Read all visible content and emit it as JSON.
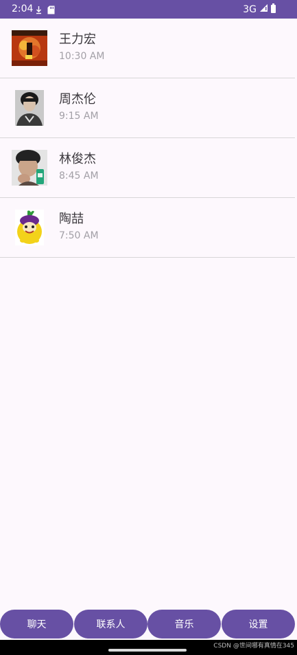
{
  "status_bar": {
    "time": "2:04",
    "network": "3G",
    "icons": [
      "download-arrow-icon",
      "sd-card-icon",
      "signal-icon",
      "battery-icon"
    ]
  },
  "chats": [
    {
      "name": "王力宏",
      "time": "10:30 AM",
      "avatar": "album-cover-avatar"
    },
    {
      "name": "周杰伦",
      "time": "9:15 AM",
      "avatar": "portrait-avatar"
    },
    {
      "name": "林俊杰",
      "time": "8:45 AM",
      "avatar": "portrait-avatar"
    },
    {
      "name": "陶喆",
      "time": "7:50 AM",
      "avatar": "cartoon-avatar"
    }
  ],
  "bottom_nav": {
    "items": [
      {
        "label": "聊天"
      },
      {
        "label": "联系人"
      },
      {
        "label": "音乐"
      },
      {
        "label": "设置"
      }
    ]
  },
  "watermark": "CSDN @世间哪有真情在345",
  "colors": {
    "primary": "#6750a4",
    "background": "#fdf8fd",
    "name_text": "#3b383d",
    "time_text": "#a29fa6",
    "divider": "#d8d6d8"
  }
}
